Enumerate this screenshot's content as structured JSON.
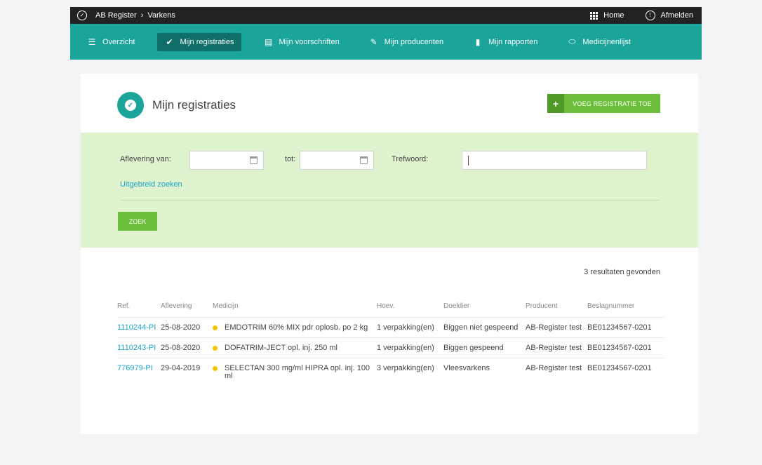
{
  "topbar": {
    "app": "AB Register",
    "separator": "›",
    "section": "Varkens",
    "home_label": "Home",
    "logout_label": "Afmelden"
  },
  "nav": {
    "items": [
      {
        "label": "Overzicht",
        "icon": "list-icon"
      },
      {
        "label": "Mijn registraties",
        "icon": "check-circle-icon"
      },
      {
        "label": "Mijn voorschriften",
        "icon": "document-icon"
      },
      {
        "label": "Mijn producenten",
        "icon": "feather-icon"
      },
      {
        "label": "Mijn rapporten",
        "icon": "bar-chart-icon"
      },
      {
        "label": "Medicijnenlijst",
        "icon": "pill-icon"
      }
    ]
  },
  "page": {
    "title": "Mijn registraties",
    "add_button": "VOEG REGISTRATIE TOE"
  },
  "filter": {
    "from_label": "Aflevering van:",
    "to_label": "tot:",
    "keyword_label": "Trefwoord:",
    "from_value": "",
    "to_value": "",
    "keyword_value": "",
    "advanced_link": "Uitgebreid zoeken",
    "search_button": "ZOEK"
  },
  "results": {
    "count_text": "3 resultaten gevonden",
    "headers": [
      "Ref.",
      "Aflevering",
      "Medicijn",
      "Hoev.",
      "Doeldier",
      "Producent",
      "Beslagnummer"
    ],
    "rows": [
      {
        "ref": "1110244-PI",
        "date": "25-08-2020",
        "medicine": "EMDOTRIM 60% MIX pdr oplosb. po 2 kg",
        "qty": "1 verpakking(en)",
        "animal": "Biggen niet gespeend",
        "producer": "AB-Register test",
        "number": "BE01234567-0201"
      },
      {
        "ref": "1110243-PI",
        "date": "25-08-2020",
        "medicine": "DOFATRIM-JECT opl. inj. 250 ml",
        "qty": "1 verpakking(en)",
        "animal": "Biggen gespeend",
        "producer": "AB-Register test",
        "number": "BE01234567-0201"
      },
      {
        "ref": "776979-PI",
        "date": "29-04-2019",
        "medicine": "SELECTAN 300 mg/ml HIPRA opl. inj. 100 ml",
        "qty": "3 verpakking(en)",
        "animal": "Vleesvarkens",
        "producer": "AB-Register test",
        "number": "BE01234567-0201"
      }
    ]
  },
  "colors": {
    "teal": "#1ba49a",
    "active_nav": "#0e6f68",
    "green_button": "#6cbf3a",
    "filter_bg": "#dff3cf",
    "link": "#1aa3c7",
    "status_dot": "#f5c400"
  }
}
